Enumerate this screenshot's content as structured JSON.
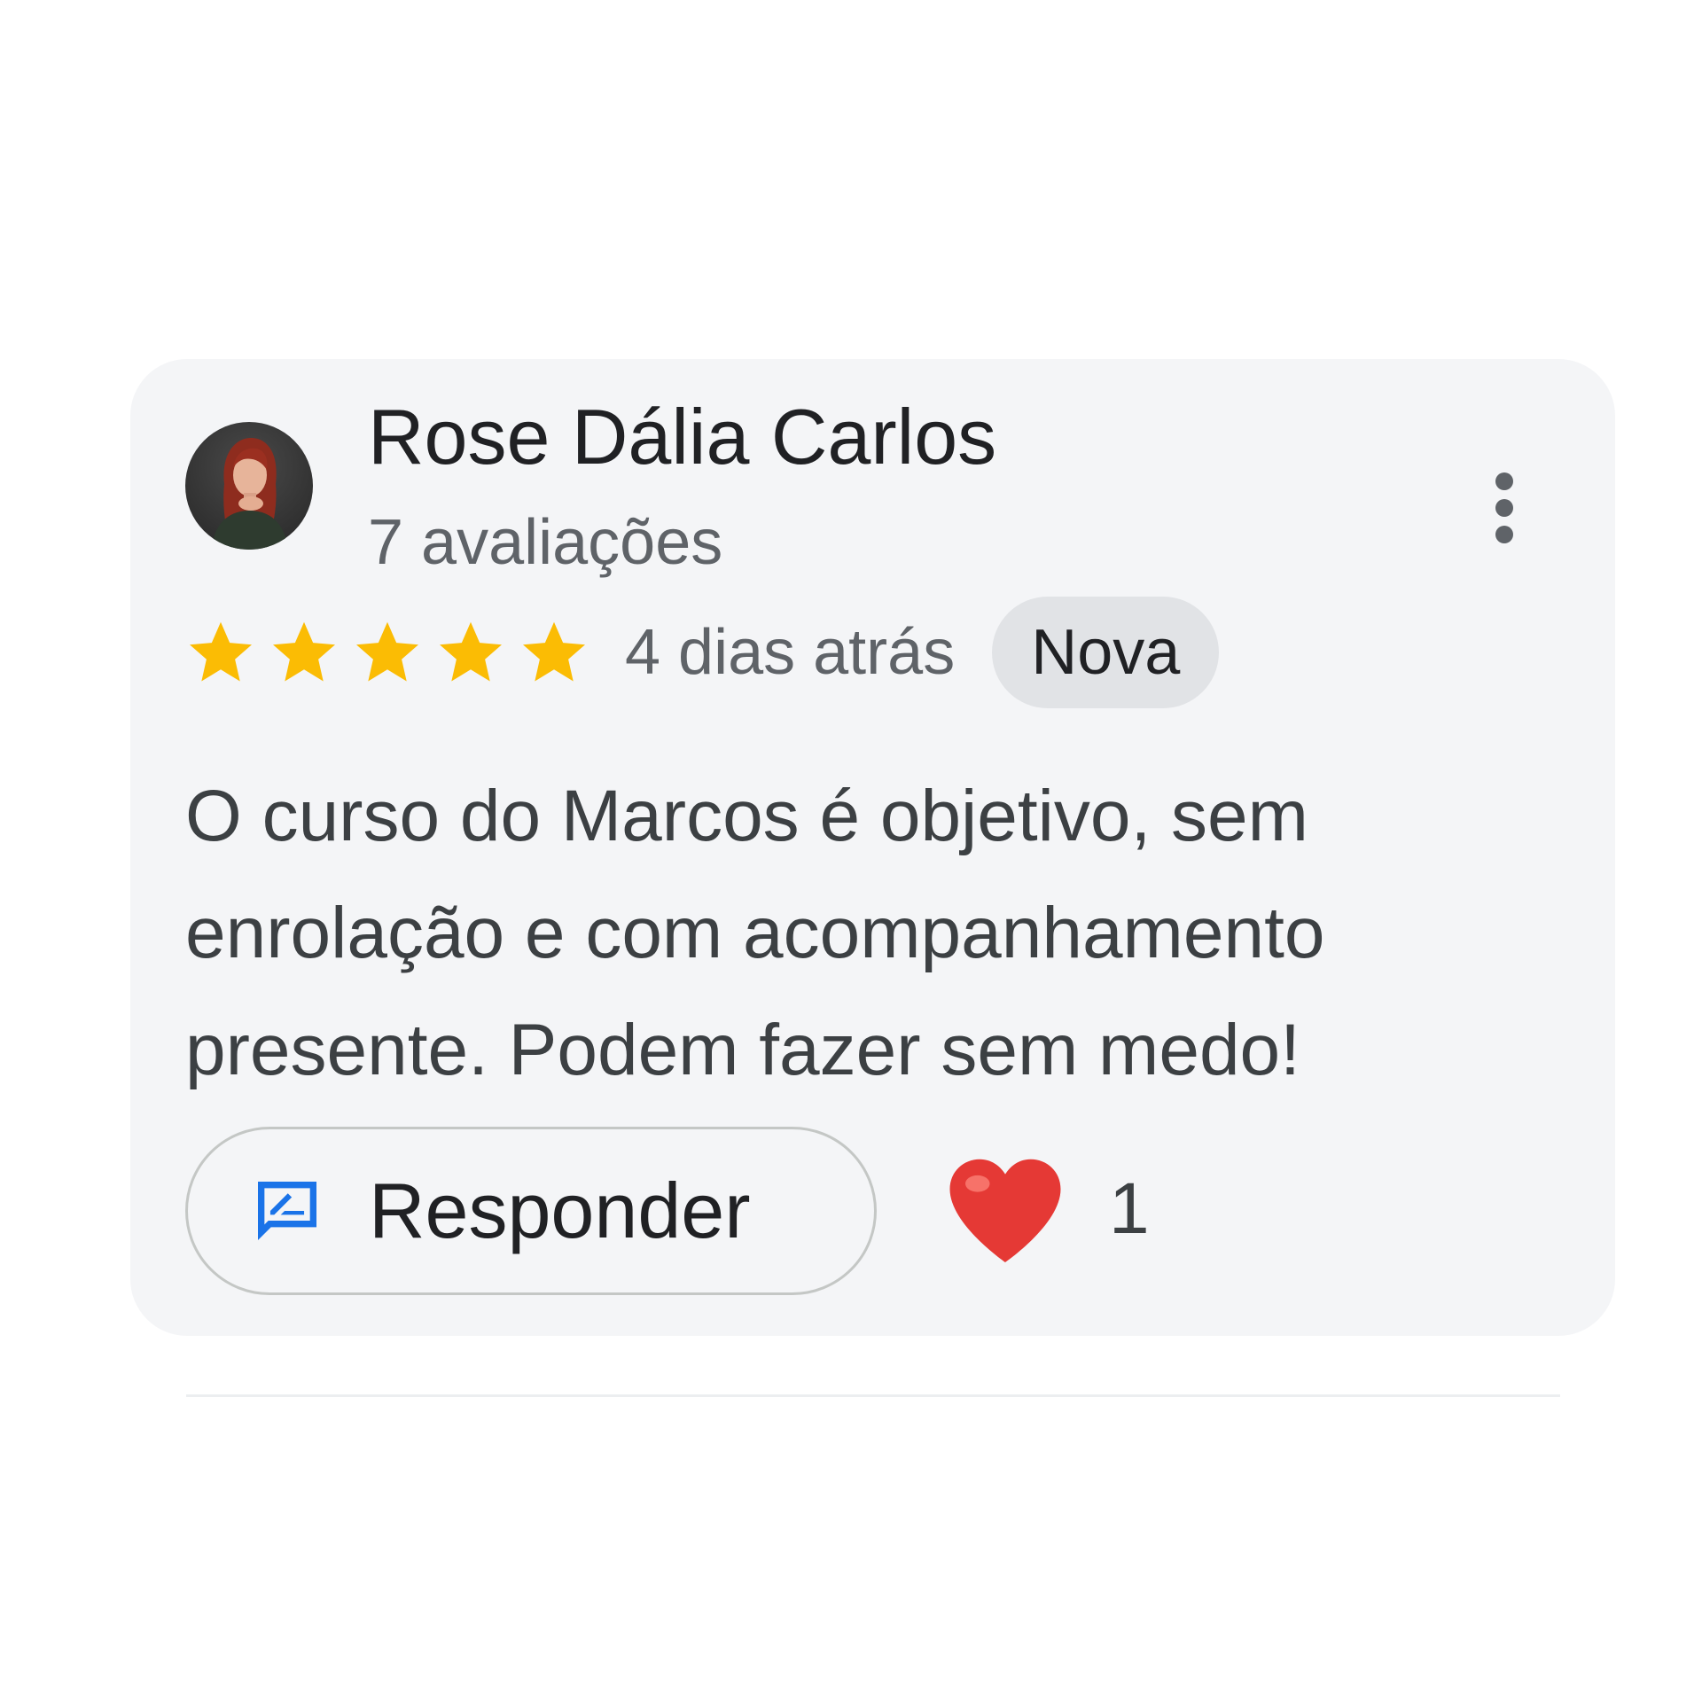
{
  "review": {
    "reviewer_name": "Rose Dália Carlos",
    "review_count": "7 avaliações",
    "rating": 5,
    "rating_max": 5,
    "date": "4 dias atrás",
    "badge": "Nova",
    "text": "O curso do Marcos é objetivo, sem enrolação e com acompanhamento presente. Podem fazer sem medo!",
    "more_icon": "more-vert-icon"
  },
  "actions": {
    "reply_label": "Responder",
    "reply_icon": "rate-review-icon",
    "reaction_icon": "heart-icon",
    "reaction_count": "1"
  },
  "colors": {
    "star": "#fbbc04",
    "card_background": "#f4f5f7",
    "badge_background": "#e1e3e6",
    "reply_icon": "#1a73e8",
    "heart": "#e53935"
  }
}
